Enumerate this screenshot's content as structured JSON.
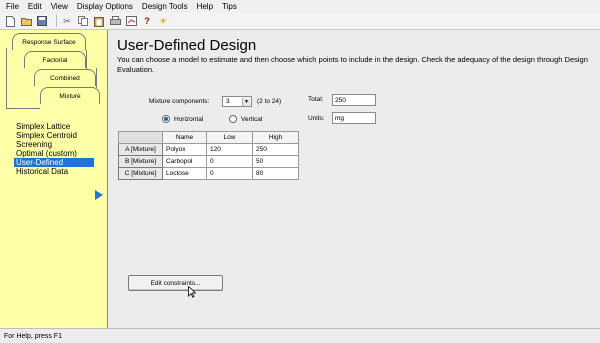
{
  "menu": [
    "File",
    "Edit",
    "View",
    "Display Options",
    "Design Tools",
    "Help",
    "Tips"
  ],
  "toolbar_icons": [
    "new-file-icon",
    "open-folder-icon",
    "save-icon",
    "cut-icon",
    "copy-icon",
    "paste-icon",
    "print-icon",
    "copy-graph-icon",
    "help-icon",
    "tip-bulb-icon"
  ],
  "tabs": {
    "response_surface": "Response Surface",
    "factorial": "Factorial",
    "combined": "Combined",
    "mixture": "Mixture"
  },
  "design_list": [
    "Simplex Lattice",
    "Simplex Centroid",
    "Screening",
    "Optimal (custom)",
    "User-Defined",
    "Historical Data"
  ],
  "selected_design": "User-Defined",
  "main": {
    "title": "User-Defined Design",
    "description": "You can choose a model to estimate and then choose which points to include in the design.  Check the adequacy of the design through Design Evaluation."
  },
  "form": {
    "mixture_components_label": "Mixture components:",
    "mixture_components_value": "3",
    "mixture_components_range": "(2 to 24)",
    "total_label": "Total:",
    "total_value": "250",
    "units_label": "Units:",
    "units_value": "mg",
    "orientation_horizontal": "Horizontal",
    "orientation_vertical": "Vertical",
    "orientation_selected": "Horizontal"
  },
  "table": {
    "headers": [
      "Name",
      "Low",
      "High"
    ],
    "rows": [
      {
        "label": "A [Mixture]",
        "name": "Polyox",
        "low": "120",
        "high": "250"
      },
      {
        "label": "B [Mixture]",
        "name": "Carbopol",
        "low": "0",
        "high": "50"
      },
      {
        "label": "C [Mixture]",
        "name": "Loctose",
        "low": "0",
        "high": "80"
      }
    ]
  },
  "edit_constraints_label": "Edit constraints...",
  "status": "For Help, press F1",
  "colors": {
    "panel_yellow": "#ffffa8",
    "selection_blue": "#1e74d6"
  }
}
